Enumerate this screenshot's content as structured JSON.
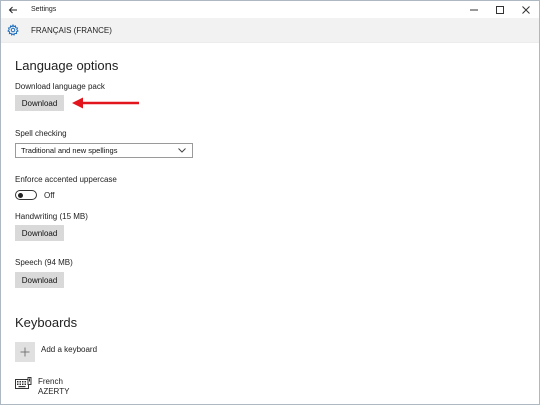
{
  "window": {
    "title": "Settings"
  },
  "header": {
    "language": "FRANÇAIS (FRANCE)"
  },
  "language_options": {
    "heading": "Language options",
    "download_pack_label": "Download language pack",
    "download_pack_button": "Download",
    "spell_label": "Spell checking",
    "spell_value": "Traditional and new spellings",
    "accent_label": "Enforce accented uppercase",
    "accent_state": "Off",
    "handwriting_label": "Handwriting (15 MB)",
    "handwriting_button": "Download",
    "speech_label": "Speech (94 MB)",
    "speech_button": "Download"
  },
  "keyboards": {
    "heading": "Keyboards",
    "add_label": "Add a keyboard",
    "items": [
      {
        "name": "French",
        "layout": "AZERTY"
      }
    ]
  },
  "colors": {
    "arrow": "#e2151c",
    "button_bg": "#d9d9d9",
    "header_bg": "#f2f2f2",
    "gear": "#1f6fbf"
  }
}
